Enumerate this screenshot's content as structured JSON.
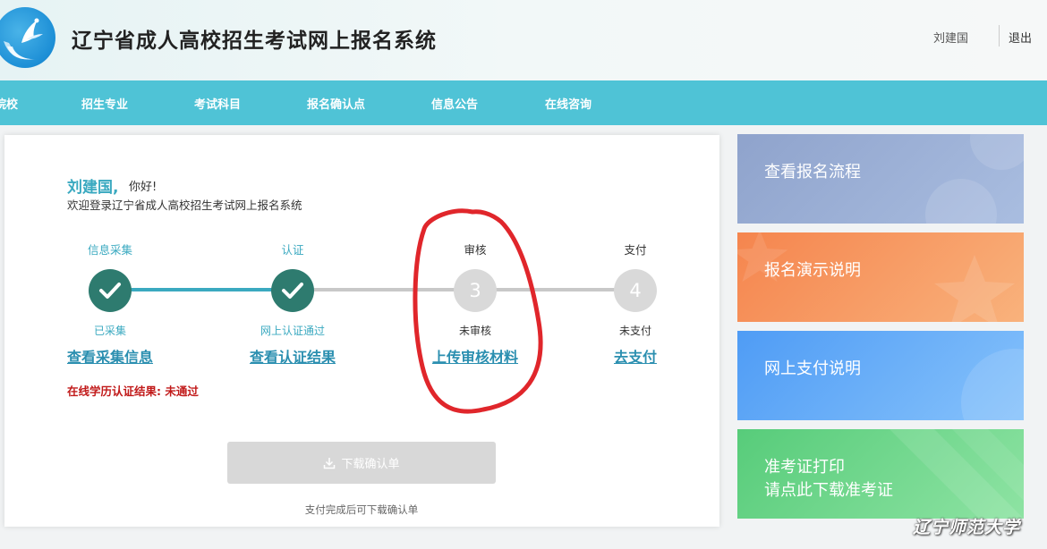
{
  "header": {
    "title": "辽宁省成人高校招生考试网上报名系统",
    "user_name": "刘建国",
    "logout_label": "退出"
  },
  "nav": {
    "items": [
      "院校",
      "招生专业",
      "考试科目",
      "报名确认点",
      "信息公告",
      "在线咨询"
    ]
  },
  "main": {
    "greeting_name": "刘建国,",
    "greeting_hello": "你好!",
    "welcome_text": "欢迎登录辽宁省成人高校招生考试网上报名系统",
    "steps": [
      {
        "title": "信息采集",
        "status": "已采集",
        "link": "查看采集信息",
        "state": "done",
        "number": ""
      },
      {
        "title": "认证",
        "status": "网上认证通过",
        "link": "查看认证结果",
        "state": "done",
        "number": ""
      },
      {
        "title": "审核",
        "status": "未审核",
        "link": "上传审核材料",
        "state": "todo",
        "number": "3"
      },
      {
        "title": "支付",
        "status": "未支付",
        "link": "去支付",
        "state": "todo",
        "number": "4"
      }
    ],
    "cert_result_label": "在线学历认证结果:",
    "cert_result_value": "未通过",
    "download_button_label": "下载确认单",
    "download_note": "支付完成后可下载确认单"
  },
  "tiles": [
    {
      "label": "查看报名流程",
      "color": "#8fa3cc"
    },
    {
      "label": "报名演示说明",
      "color": "#f5854e"
    },
    {
      "label": "网上支付说明",
      "color": "#4f9cf5"
    },
    {
      "line1": "准考证打印",
      "line2": "请点此下载准考证",
      "color": "#57cc7a"
    }
  ],
  "watermark": "辽宁师范大学",
  "colors": {
    "accent": "#3aa9c0",
    "nav_bg": "#4fc3d6",
    "check_circle": "#2e7b6f",
    "error_red": "#c11a1a"
  }
}
